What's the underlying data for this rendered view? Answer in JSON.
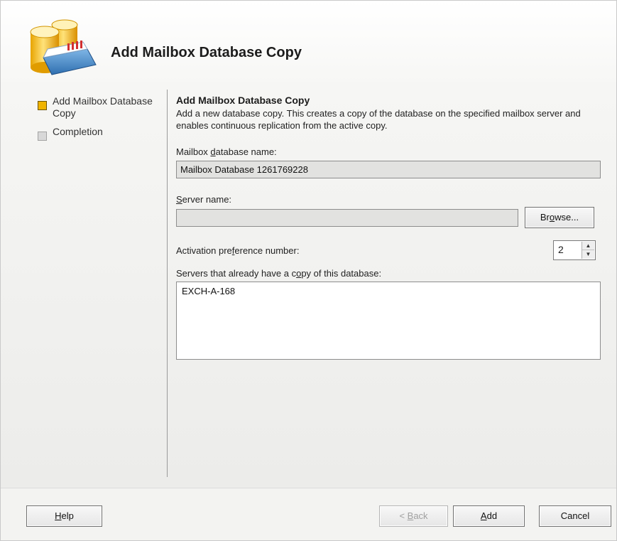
{
  "header": {
    "title": "Add Mailbox Database Copy",
    "icon": "database-wizard-icon"
  },
  "nav": {
    "items": [
      {
        "label": "Add Mailbox Database Copy",
        "state": "active"
      },
      {
        "label": "Completion",
        "state": "inactive"
      }
    ]
  },
  "content": {
    "title": "Add Mailbox Database Copy",
    "description": "Add a new database copy. This creates a copy of the database on the specified mailbox server and enables continuous replication from the active copy.",
    "db_name_label_pre": "Mailbox ",
    "db_name_label_key": "d",
    "db_name_label_post": "atabase name:",
    "db_name_value": "Mailbox Database 1261769228",
    "server_label_key": "S",
    "server_label_post": "erver name:",
    "server_value": "",
    "browse_label_pre": "Br",
    "browse_label_key": "o",
    "browse_label_post": "wse...",
    "activation_label_pre": "Activation pre",
    "activation_label_key": "f",
    "activation_label_post": "erence number:",
    "activation_value": "2",
    "servers_label_pre": "Servers that already have a c",
    "servers_label_key": "o",
    "servers_label_post": "py of this database:",
    "servers_list": [
      "EXCH-A-168"
    ]
  },
  "footer": {
    "help_key": "H",
    "help_post": "elp",
    "back_pre": "< ",
    "back_key": "B",
    "back_post": "ack",
    "add_key": "A",
    "add_post": "dd",
    "cancel_label": "Cancel"
  },
  "colors": {
    "active_marker": "#f0b400",
    "inactive_marker": "#d8d8d8",
    "disabled_text": "#a0a0a0"
  }
}
